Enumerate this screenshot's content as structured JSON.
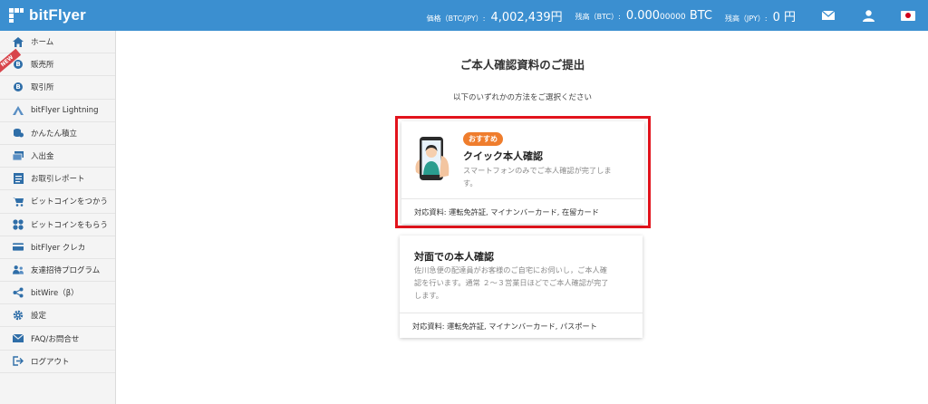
{
  "header": {
    "brand": "bitFlyer",
    "price_label": "価格（BTC/JPY）:",
    "price_value": "4,002,439円",
    "btc_balance_label": "残高（BTC）:",
    "btc_balance_main": "0.000",
    "btc_balance_minor": "00000",
    "btc_unit": "BTC",
    "jpy_balance_label": "残高（JPY）:",
    "jpy_balance_value": "0 円"
  },
  "sidebar": {
    "new_badge": "NEW",
    "items": [
      {
        "label": "ホーム",
        "icon": "home-icon"
      },
      {
        "label": "販売所",
        "icon": "bitcoin-coin-icon"
      },
      {
        "label": "取引所",
        "icon": "bitcoin-coin-icon"
      },
      {
        "label": "bitFlyer Lightning",
        "icon": "lightning-icon"
      },
      {
        "label": "かんたん積立",
        "icon": "coin-stack-icon"
      },
      {
        "label": "入出金",
        "icon": "deposit-icon"
      },
      {
        "label": "お取引レポート",
        "icon": "report-icon"
      },
      {
        "label": "ビットコインをつかう",
        "icon": "cart-icon"
      },
      {
        "label": "ビットコインをもらう",
        "icon": "gift-icon"
      },
      {
        "label": "bitFlyer クレカ",
        "icon": "credit-card-icon"
      },
      {
        "label": "友達招待プログラム",
        "icon": "invite-friends-icon"
      },
      {
        "label": "bitWire（β）",
        "icon": "share-icon"
      },
      {
        "label": "設定",
        "icon": "gear-icon"
      },
      {
        "label": "FAQ/お問合せ",
        "icon": "mail-icon"
      },
      {
        "label": "ログアウト",
        "icon": "logout-icon"
      }
    ]
  },
  "main": {
    "title": "ご本人確認資料のご提出",
    "subtitle": "以下のいずれかの方法をご選択ください",
    "quick": {
      "badge": "おすすめ",
      "title": "クイック本人確認",
      "desc_line1": "スマートフォンのみでご本人確認が完了しま",
      "desc_line2": "す。",
      "documents": "対応資料: 運転免許証, マイナンバーカード, 在留カード"
    },
    "inperson": {
      "title": "対面での本人確認",
      "desc_line1": "佐川急便の配達員がお客様のご自宅にお伺いし，ご本人確",
      "desc_line2": "認を行います。通常 ２～３営業日ほどでご本人確認が完了",
      "desc_line3": "します。",
      "documents": "対応資料: 運転免許証, マイナンバーカード, パスポート"
    }
  },
  "colors": {
    "header_bg": "#3b8fd0",
    "highlight_border": "#e2131c",
    "badge_bg": "#ef7d2d"
  }
}
